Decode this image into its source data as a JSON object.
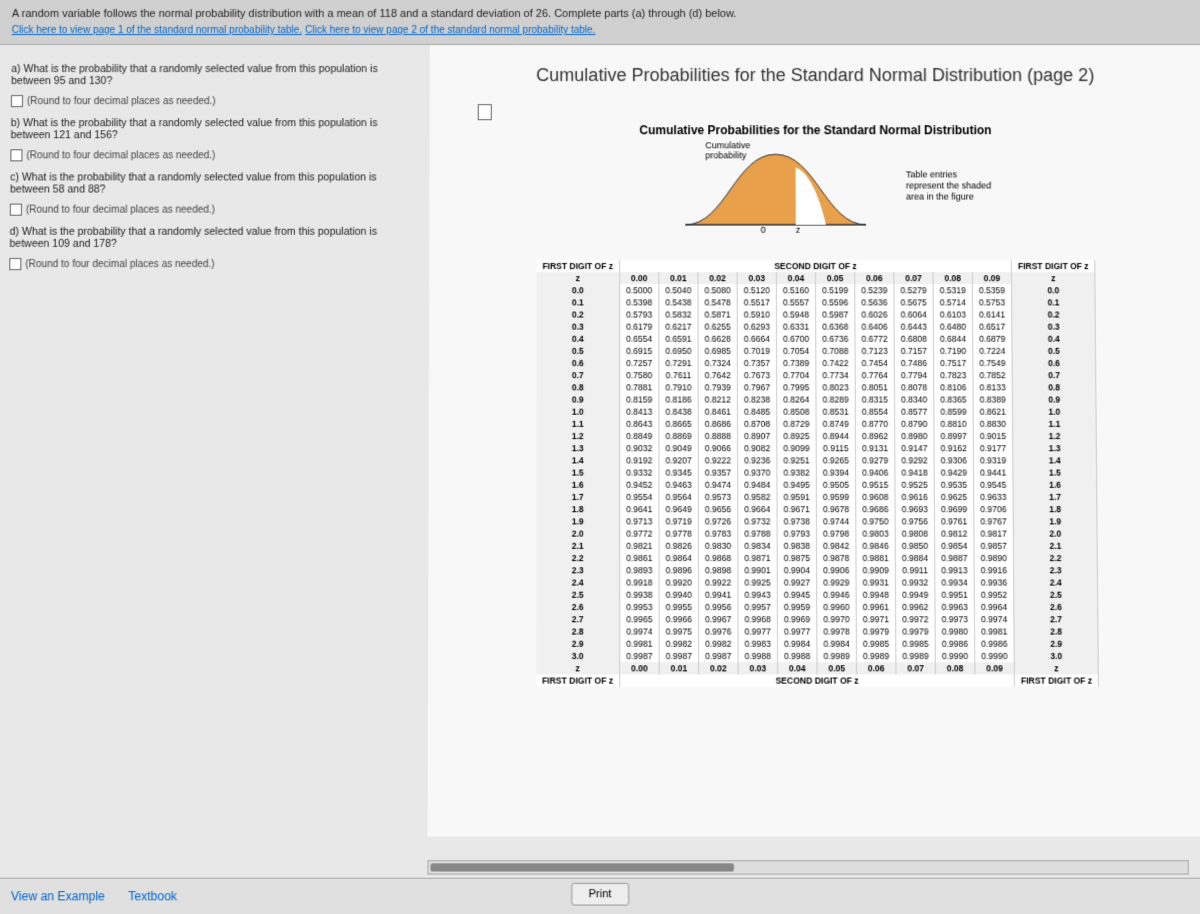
{
  "problem": {
    "statement": "A random variable follows the normal probability distribution with a mean of 118 and a standard deviation of 26. Complete parts (a) through (d) below.",
    "link1": "Click here to view page 1 of the standard normal probability table.",
    "link2": "Click here to view page 2 of the standard normal probability table."
  },
  "questions": {
    "a": "a) What is the probability that a randomly selected value from this population is between 95 and 130?",
    "b": "b) What is the probability that a randomly selected value from this population is between 121 and 156?",
    "c": "c) What is the probability that a randomly selected value from this population is between 58 and 88?",
    "d": "d) What is the probability that a randomly selected value from this population is between 109 and 178?",
    "round": "(Round to four decimal places as needed.)"
  },
  "page": {
    "title": "Cumulative Probabilities for the Standard Normal Distribution (page 2)",
    "subtitle": "Cumulative Probabilities for the Standard Normal Distribution"
  },
  "diagram": {
    "cum_label": "Cumulative\nprobability",
    "entries": "Table entries\nrepresent the shaded\narea in the figure",
    "zero": "0",
    "z": "z"
  },
  "table": {
    "first_digit": "FIRST DIGIT OF z",
    "second_digit": "SECOND DIGIT OF z",
    "z": "z",
    "cols": [
      "0.00",
      "0.01",
      "0.02",
      "0.03",
      "0.04",
      "0.05",
      "0.06",
      "0.07",
      "0.08",
      "0.09"
    ],
    "rows": [
      {
        "z": "0.0",
        "v": [
          "0.5000",
          "0.5040",
          "0.5080",
          "0.5120",
          "0.5160",
          "0.5199",
          "0.5239",
          "0.5279",
          "0.5319",
          "0.5359"
        ]
      },
      {
        "z": "0.1",
        "v": [
          "0.5398",
          "0.5438",
          "0.5478",
          "0.5517",
          "0.5557",
          "0.5596",
          "0.5636",
          "0.5675",
          "0.5714",
          "0.5753"
        ]
      },
      {
        "z": "0.2",
        "v": [
          "0.5793",
          "0.5832",
          "0.5871",
          "0.5910",
          "0.5948",
          "0.5987",
          "0.6026",
          "0.6064",
          "0.6103",
          "0.6141"
        ]
      },
      {
        "z": "0.3",
        "v": [
          "0.6179",
          "0.6217",
          "0.6255",
          "0.6293",
          "0.6331",
          "0.6368",
          "0.6406",
          "0.6443",
          "0.6480",
          "0.6517"
        ]
      },
      {
        "z": "0.4",
        "v": [
          "0.6554",
          "0.6591",
          "0.6628",
          "0.6664",
          "0.6700",
          "0.6736",
          "0.6772",
          "0.6808",
          "0.6844",
          "0.6879"
        ]
      },
      {
        "z": "0.5",
        "v": [
          "0.6915",
          "0.6950",
          "0.6985",
          "0.7019",
          "0.7054",
          "0.7088",
          "0.7123",
          "0.7157",
          "0.7190",
          "0.7224"
        ]
      },
      {
        "z": "0.6",
        "v": [
          "0.7257",
          "0.7291",
          "0.7324",
          "0.7357",
          "0.7389",
          "0.7422",
          "0.7454",
          "0.7486",
          "0.7517",
          "0.7549"
        ]
      },
      {
        "z": "0.7",
        "v": [
          "0.7580",
          "0.7611",
          "0.7642",
          "0.7673",
          "0.7704",
          "0.7734",
          "0.7764",
          "0.7794",
          "0.7823",
          "0.7852"
        ]
      },
      {
        "z": "0.8",
        "v": [
          "0.7881",
          "0.7910",
          "0.7939",
          "0.7967",
          "0.7995",
          "0.8023",
          "0.8051",
          "0.8078",
          "0.8106",
          "0.8133"
        ]
      },
      {
        "z": "0.9",
        "v": [
          "0.8159",
          "0.8186",
          "0.8212",
          "0.8238",
          "0.8264",
          "0.8289",
          "0.8315",
          "0.8340",
          "0.8365",
          "0.8389"
        ]
      },
      {
        "z": "1.0",
        "v": [
          "0.8413",
          "0.8438",
          "0.8461",
          "0.8485",
          "0.8508",
          "0.8531",
          "0.8554",
          "0.8577",
          "0.8599",
          "0.8621"
        ]
      },
      {
        "z": "1.1",
        "v": [
          "0.8643",
          "0.8665",
          "0.8686",
          "0.8708",
          "0.8729",
          "0.8749",
          "0.8770",
          "0.8790",
          "0.8810",
          "0.8830"
        ]
      },
      {
        "z": "1.2",
        "v": [
          "0.8849",
          "0.8869",
          "0.8888",
          "0.8907",
          "0.8925",
          "0.8944",
          "0.8962",
          "0.8980",
          "0.8997",
          "0.9015"
        ]
      },
      {
        "z": "1.3",
        "v": [
          "0.9032",
          "0.9049",
          "0.9066",
          "0.9082",
          "0.9099",
          "0.9115",
          "0.9131",
          "0.9147",
          "0.9162",
          "0.9177"
        ]
      },
      {
        "z": "1.4",
        "v": [
          "0.9192",
          "0.9207",
          "0.9222",
          "0.9236",
          "0.9251",
          "0.9265",
          "0.9279",
          "0.9292",
          "0.9306",
          "0.9319"
        ]
      },
      {
        "z": "1.5",
        "v": [
          "0.9332",
          "0.9345",
          "0.9357",
          "0.9370",
          "0.9382",
          "0.9394",
          "0.9406",
          "0.9418",
          "0.9429",
          "0.9441"
        ]
      },
      {
        "z": "1.6",
        "v": [
          "0.9452",
          "0.9463",
          "0.9474",
          "0.9484",
          "0.9495",
          "0.9505",
          "0.9515",
          "0.9525",
          "0.9535",
          "0.9545"
        ]
      },
      {
        "z": "1.7",
        "v": [
          "0.9554",
          "0.9564",
          "0.9573",
          "0.9582",
          "0.9591",
          "0.9599",
          "0.9608",
          "0.9616",
          "0.9625",
          "0.9633"
        ]
      },
      {
        "z": "1.8",
        "v": [
          "0.9641",
          "0.9649",
          "0.9656",
          "0.9664",
          "0.9671",
          "0.9678",
          "0.9686",
          "0.9693",
          "0.9699",
          "0.9706"
        ]
      },
      {
        "z": "1.9",
        "v": [
          "0.9713",
          "0.9719",
          "0.9726",
          "0.9732",
          "0.9738",
          "0.9744",
          "0.9750",
          "0.9756",
          "0.9761",
          "0.9767"
        ]
      },
      {
        "z": "2.0",
        "v": [
          "0.9772",
          "0.9778",
          "0.9783",
          "0.9788",
          "0.9793",
          "0.9798",
          "0.9803",
          "0.9808",
          "0.9812",
          "0.9817"
        ]
      },
      {
        "z": "2.1",
        "v": [
          "0.9821",
          "0.9826",
          "0.9830",
          "0.9834",
          "0.9838",
          "0.9842",
          "0.9846",
          "0.9850",
          "0.9854",
          "0.9857"
        ]
      },
      {
        "z": "2.2",
        "v": [
          "0.9861",
          "0.9864",
          "0.9868",
          "0.9871",
          "0.9875",
          "0.9878",
          "0.9881",
          "0.9884",
          "0.9887",
          "0.9890"
        ]
      },
      {
        "z": "2.3",
        "v": [
          "0.9893",
          "0.9896",
          "0.9898",
          "0.9901",
          "0.9904",
          "0.9906",
          "0.9909",
          "0.9911",
          "0.9913",
          "0.9916"
        ]
      },
      {
        "z": "2.4",
        "v": [
          "0.9918",
          "0.9920",
          "0.9922",
          "0.9925",
          "0.9927",
          "0.9929",
          "0.9931",
          "0.9932",
          "0.9934",
          "0.9936"
        ]
      },
      {
        "z": "2.5",
        "v": [
          "0.9938",
          "0.9940",
          "0.9941",
          "0.9943",
          "0.9945",
          "0.9946",
          "0.9948",
          "0.9949",
          "0.9951",
          "0.9952"
        ]
      },
      {
        "z": "2.6",
        "v": [
          "0.9953",
          "0.9955",
          "0.9956",
          "0.9957",
          "0.9959",
          "0.9960",
          "0.9961",
          "0.9962",
          "0.9963",
          "0.9964"
        ]
      },
      {
        "z": "2.7",
        "v": [
          "0.9965",
          "0.9966",
          "0.9967",
          "0.9968",
          "0.9969",
          "0.9970",
          "0.9971",
          "0.9972",
          "0.9973",
          "0.9974"
        ]
      },
      {
        "z": "2.8",
        "v": [
          "0.9974",
          "0.9975",
          "0.9976",
          "0.9977",
          "0.9977",
          "0.9978",
          "0.9979",
          "0.9979",
          "0.9980",
          "0.9981"
        ]
      },
      {
        "z": "2.9",
        "v": [
          "0.9981",
          "0.9982",
          "0.9982",
          "0.9983",
          "0.9984",
          "0.9984",
          "0.9985",
          "0.9985",
          "0.9986",
          "0.9986"
        ]
      },
      {
        "z": "3.0",
        "v": [
          "0.9987",
          "0.9987",
          "0.9987",
          "0.9988",
          "0.9988",
          "0.9989",
          "0.9989",
          "0.9989",
          "0.9990",
          "0.9990"
        ]
      }
    ]
  },
  "footer": {
    "view_example": "View an Example",
    "textbook": "Textbook",
    "print": "Print"
  }
}
